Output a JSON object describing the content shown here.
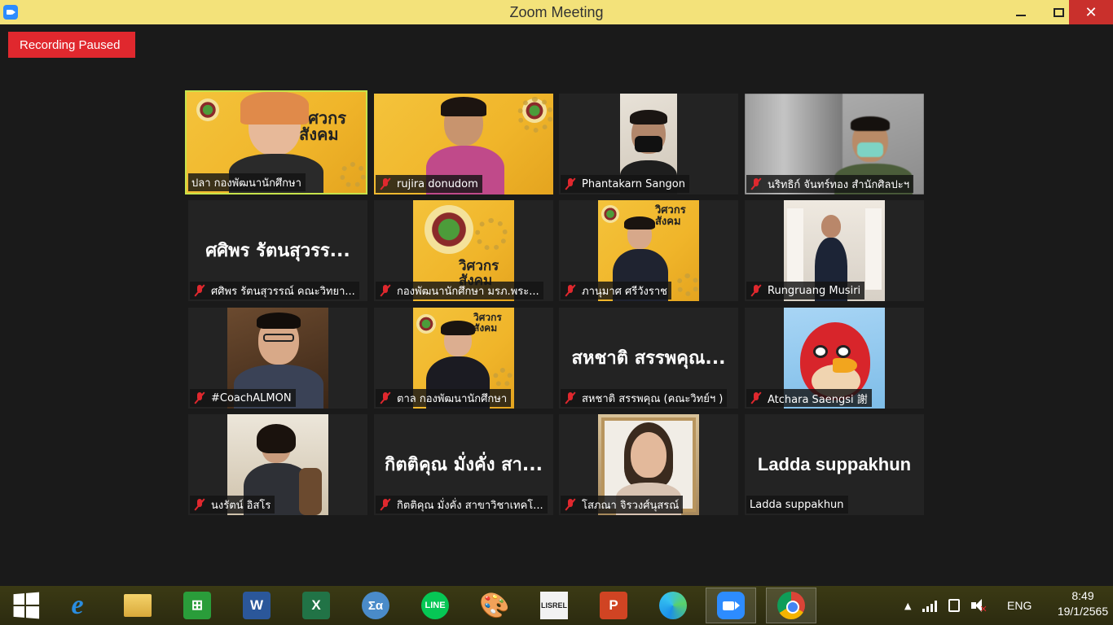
{
  "window": {
    "title": "Zoom Meeting"
  },
  "recording": {
    "label": "Recording Paused"
  },
  "participants": [
    {
      "name": "ปลา กองพัฒนานักศึกษา",
      "muted": false,
      "active": true,
      "video": true
    },
    {
      "name": "rujira donudom",
      "muted": true,
      "video": true
    },
    {
      "name": "Phantakarn Sangon",
      "muted": true,
      "video": true
    },
    {
      "name": "นริทธิก์ จันทร์ทอง สำนักศิลปะฯ",
      "muted": true,
      "video": true
    },
    {
      "name": "ศศิพร รัตนสุวรรณ์ คณะวิทยา...",
      "display_name": "ศศิพร รัตนสุวรร...",
      "muted": true,
      "video": false
    },
    {
      "name": "กองพัฒนานักศึกษา มรภ.พระ...",
      "muted": true,
      "video": true
    },
    {
      "name": "ภานุมาศ ศรีวังราช",
      "muted": true,
      "video": true
    },
    {
      "name": "Rungruang Musiri",
      "muted": true,
      "video": true
    },
    {
      "name": "#CoachALMON",
      "muted": true,
      "video": true
    },
    {
      "name": "ตาล กองพัฒนานักศึกษา",
      "muted": true,
      "video": true
    },
    {
      "name": "สหชาติ สรรพคุณ (คณะวิทย์ฯ )",
      "display_name": "สหชาติ สรรพคุณ...",
      "muted": true,
      "video": false
    },
    {
      "name": "Atchara Saengsi 謝",
      "muted": true,
      "video": true
    },
    {
      "name": "นงรัตน์ อิสโร",
      "muted": true,
      "video": true
    },
    {
      "name": "กิตติคุณ  มั่งคั่ง สาขาวิชาเทคโ...",
      "display_name": "กิตติคุณ  มั่งคั่ง สา...",
      "muted": true,
      "video": false
    },
    {
      "name": "โสภณา จิรวงศ์นุสรณ์",
      "muted": true,
      "video": true
    },
    {
      "name": "Ladda suppakhun",
      "display_name": "Ladda suppakhun",
      "muted": false,
      "video": false
    }
  ],
  "slide_text": {
    "main": "วิศวกรสังคม"
  },
  "taskbar": {
    "apps": [
      {
        "name": "internet-explorer",
        "glyph": "e"
      },
      {
        "name": "file-explorer",
        "glyph": ""
      },
      {
        "name": "store",
        "glyph": "⊞"
      },
      {
        "name": "word",
        "glyph": "W"
      },
      {
        "name": "excel",
        "glyph": "X"
      },
      {
        "name": "math-input",
        "glyph": "Σα"
      },
      {
        "name": "line",
        "glyph": "LINE"
      },
      {
        "name": "paint",
        "glyph": "🎨"
      },
      {
        "name": "lisrel",
        "glyph": "LISREL"
      },
      {
        "name": "powerpoint",
        "glyph": "P"
      },
      {
        "name": "edge",
        "glyph": ""
      },
      {
        "name": "zoom",
        "glyph": ""
      },
      {
        "name": "chrome",
        "glyph": ""
      }
    ],
    "language": "ENG",
    "time": "8:49",
    "date": "19/1/2565",
    "tray_up": "▲"
  },
  "colors": {
    "titlebar": "#f3e27a",
    "recording": "#e0282e",
    "active_speaker": "#c7e34b",
    "close_button": "#c9302c"
  }
}
